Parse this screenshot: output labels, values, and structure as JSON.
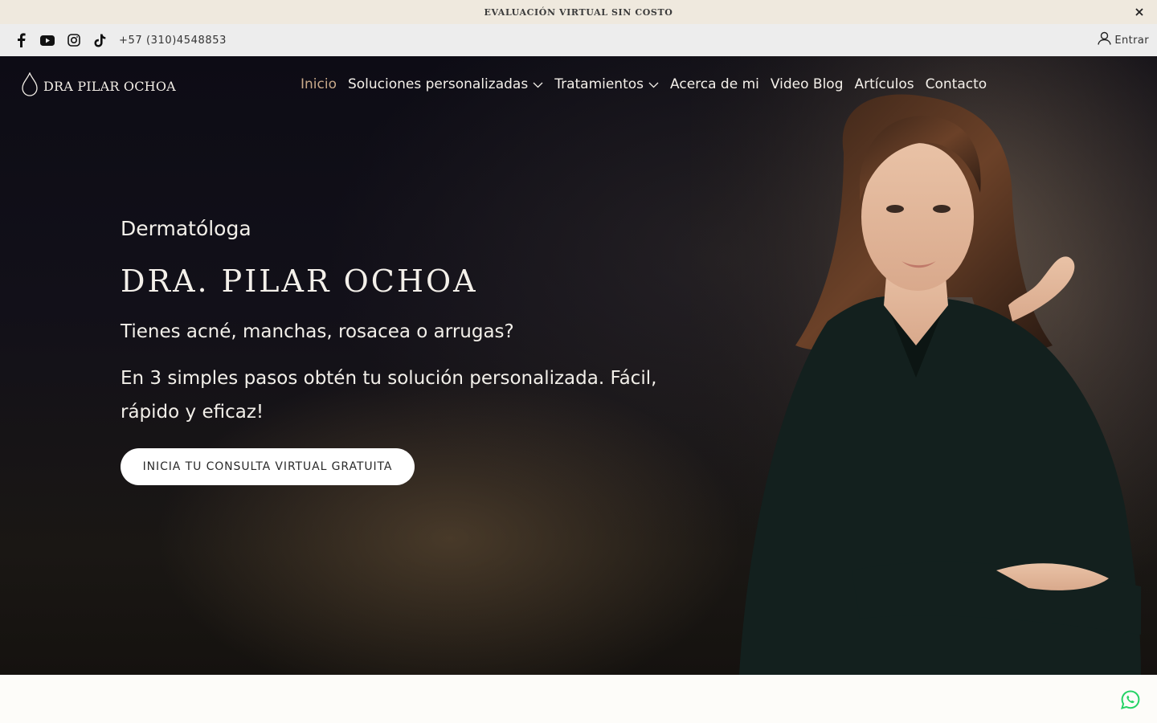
{
  "announcement": {
    "text": "EVALUACIÓN VIRTUAL SIN COSTO",
    "close_icon": "close-icon"
  },
  "utility_bar": {
    "social": [
      "facebook-icon",
      "youtube-icon",
      "instagram-icon",
      "tiktok-icon"
    ],
    "phone": "+57 (310)4548853",
    "login_label": "Entrar",
    "login_icon": "user-icon"
  },
  "nav": {
    "logo_text": "DRA PILAR OCHOA",
    "items": [
      {
        "label": "Inicio",
        "active": true
      },
      {
        "label": "Soluciones personalizadas",
        "has_dropdown": true
      },
      {
        "label": "Tratamientos",
        "has_dropdown": true
      },
      {
        "label": "Acerca de mi"
      },
      {
        "label": "Video Blog"
      },
      {
        "label": "Artículos"
      },
      {
        "label": "Contacto"
      }
    ]
  },
  "hero": {
    "eyebrow": "Dermatóloga",
    "title": "DRA. PILAR OCHOA",
    "line1": "Tienes acné, manchas, rosacea o arrugas?",
    "line2": "En 3 simples pasos obtén tu solución personalizada. Fácil, rápido y eficaz!",
    "cta_label": "INICIA TU CONSULTA VIRTUAL GRATUITA"
  },
  "floating": {
    "whatsapp_icon": "whatsapp-icon"
  },
  "colors": {
    "announcement_bg": "#efe9de",
    "utility_bg": "#ededed",
    "nav_active": "#c9a98a",
    "hero_text": "#f2efe9",
    "whatsapp": "#25d366"
  }
}
